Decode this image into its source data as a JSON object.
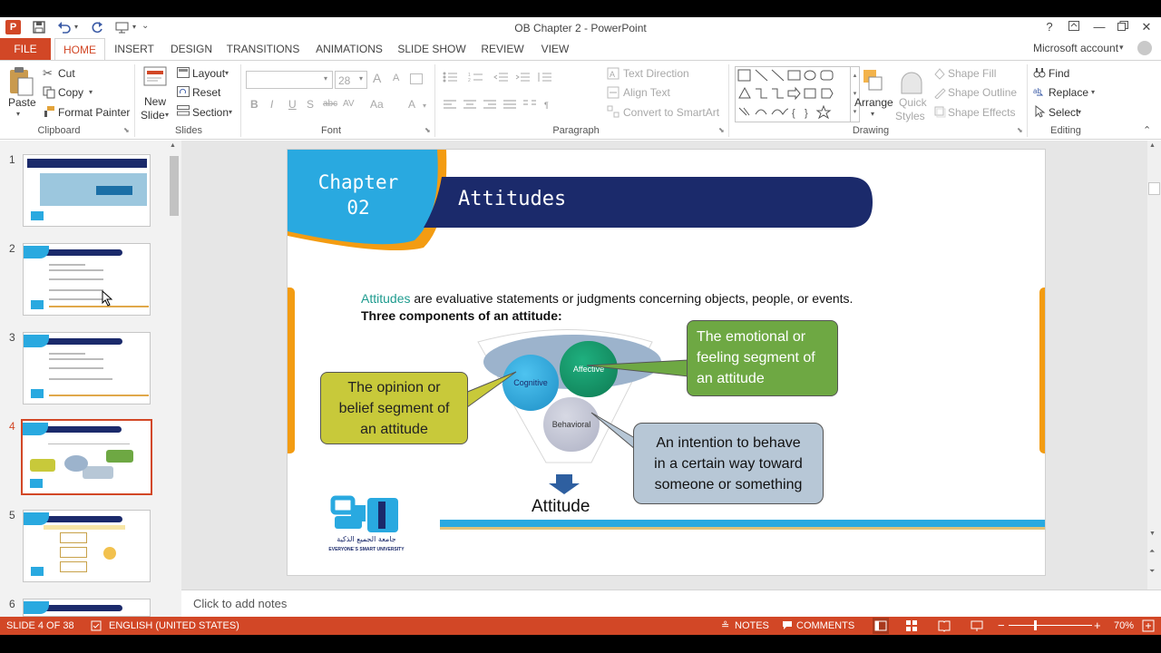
{
  "window": {
    "title": "OB Chapter 2 - PowerPoint",
    "help": "?",
    "account": "Microsoft account"
  },
  "tabs": [
    "FILE",
    "HOME",
    "INSERT",
    "DESIGN",
    "TRANSITIONS",
    "ANIMATIONS",
    "SLIDE SHOW",
    "REVIEW",
    "VIEW"
  ],
  "ribbon": {
    "clipboard": {
      "label": "Clipboard",
      "paste": "Paste",
      "cut": "Cut",
      "copy": "Copy",
      "format_painter": "Format Painter"
    },
    "slides": {
      "label": "Slides",
      "new_slide_1": "New",
      "new_slide_2": "Slide",
      "layout": "Layout",
      "reset": "Reset",
      "section": "Section"
    },
    "font": {
      "label": "Font",
      "size": "28",
      "grow": "A",
      "shrink": "A",
      "bold": "B",
      "italic": "I",
      "underline": "U",
      "strike": "S",
      "abc": "abc",
      "spacing": "AV",
      "case": "Aa",
      "color": "A"
    },
    "paragraph": {
      "label": "Paragraph",
      "text_direction": "Text Direction",
      "align_text": "Align Text",
      "convert_smartart": "Convert to SmartArt"
    },
    "drawing": {
      "label": "Drawing",
      "arrange": "Arrange",
      "quick_styles_1": "Quick",
      "quick_styles_2": "Styles",
      "shape_fill": "Shape Fill",
      "shape_outline": "Shape Outline",
      "shape_effects": "Shape Effects"
    },
    "editing": {
      "label": "Editing",
      "find": "Find",
      "replace": "Replace",
      "select": "Select"
    }
  },
  "thumbnails": [
    "1",
    "2",
    "3",
    "4",
    "5",
    "6"
  ],
  "slide": {
    "chapter_1": "Chapter",
    "chapter_2": "02",
    "title": "Attitudes",
    "intro_term": "Attitudes",
    "intro_rest": " are evaluative statements or judgments concerning objects, people, or events.",
    "components": "Three components of an attitude:",
    "cognitive": "Cognitive",
    "affective": "Affective",
    "behavioral": "Behavioral",
    "attitude": "Attitude",
    "callout_cognitive": [
      "The opinion or",
      "belief segment of",
      "an attitude"
    ],
    "callout_affective": [
      "The emotional or",
      "feeling segment of",
      "an attitude"
    ],
    "callout_behavioral": [
      "An intention to behave",
      "in a certain way toward",
      "someone or something"
    ],
    "logo_arabic": "جامعة الجميع الذكية",
    "logo_english": "EVERYONE`S SMART UNIVERSITY"
  },
  "notes_placeholder": "Click to add notes",
  "status": {
    "slide_of": "SLIDE 4 OF 38",
    "language": "ENGLISH (UNITED STATES)",
    "notes": "NOTES",
    "comments": "COMMENTS",
    "zoom": "70%",
    "minus": "−",
    "plus": "+"
  },
  "colors": {
    "accent": "#d24726",
    "navy": "#1b2a6b",
    "sky": "#29a9e0",
    "orange": "#f39c12",
    "affective_green": "#6ea843",
    "cognitive_yellow": "#c8c93a",
    "behavioral_blue": "#b7c7d6"
  }
}
